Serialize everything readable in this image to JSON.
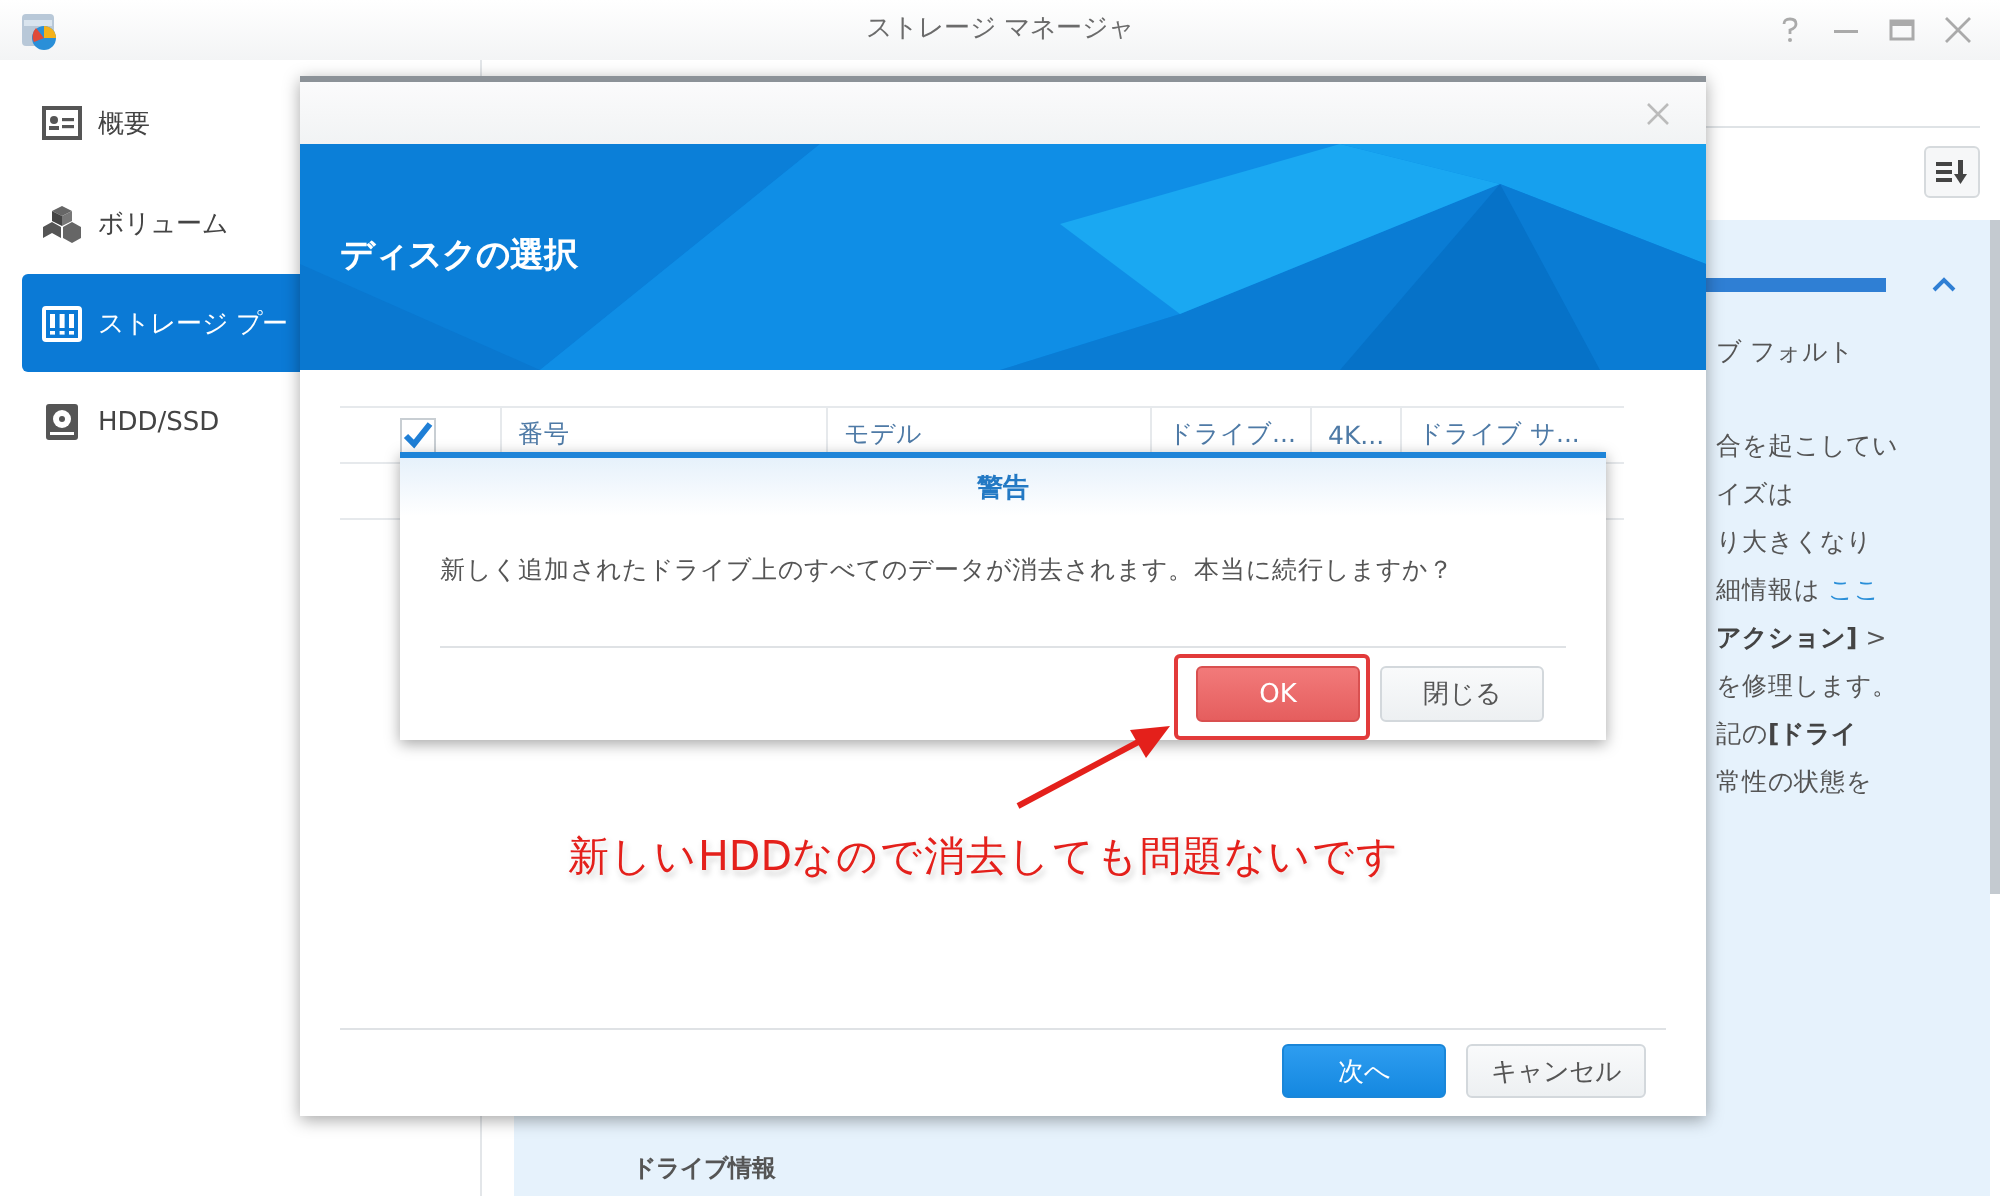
{
  "window": {
    "title": "ストレージ マネージャ"
  },
  "sidebar": {
    "items": [
      {
        "label": "概要",
        "kind": "overview",
        "selected": false
      },
      {
        "label": "ボリューム",
        "kind": "volume",
        "selected": false
      },
      {
        "label": "ストレージ プー",
        "kind": "pool",
        "selected": true
      },
      {
        "label": "HDD/SSD",
        "kind": "disk",
        "selected": false
      }
    ]
  },
  "panel": {
    "expanded": true,
    "lines": [
      {
        "text": "ブ フォルト"
      },
      {
        "text": "合を起こしてい"
      },
      {
        "text": "イズは"
      },
      {
        "text": "り大きくなり"
      },
      {
        "text": "細情報は",
        "link": "ここ"
      },
      {
        "text": "**アクション]** >"
      },
      {
        "text": "を修理します。"
      },
      {
        "text": "記の**[ドライ**"
      },
      {
        "text": "常性の状態を"
      }
    ],
    "section": "ドライブ情報"
  },
  "dialog": {
    "title": "ディスクの選択",
    "select_all_checked": true,
    "columns": [
      {
        "label": "番号"
      },
      {
        "label": "モデル"
      },
      {
        "label": "ドライブ..."
      },
      {
        "label": "4K..."
      },
      {
        "label": "ドライブ サ..."
      }
    ],
    "buttons": [
      {
        "label": "次へ",
        "kind": "primary"
      },
      {
        "label": "キャンセル",
        "kind": "secondary"
      }
    ]
  },
  "alert": {
    "title": "警告",
    "message": "新しく追加されたドライブ上のすべてのデータが消去されます。本当に続行しますか？",
    "buttons": [
      {
        "label": "OK",
        "kind": "danger",
        "highlighted": true
      },
      {
        "label": "閉じる",
        "kind": "secondary",
        "highlighted": false
      }
    ]
  },
  "annotation": {
    "text": "新しいHDDなので消去しても問題ないです"
  }
}
